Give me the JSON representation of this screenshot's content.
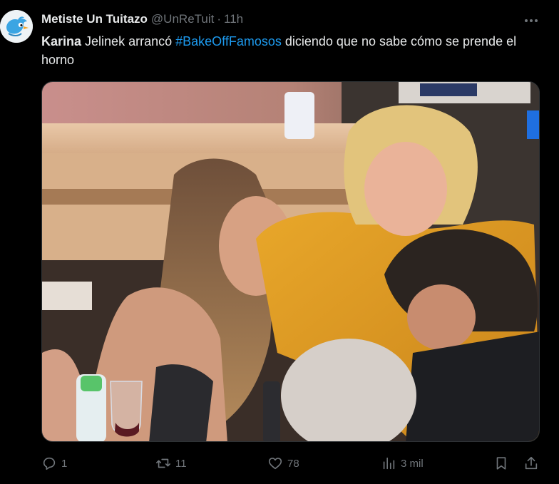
{
  "tweet": {
    "author": {
      "display_name": "Metiste Un Tuitazo",
      "handle": "@UnReTuit",
      "separator": "·",
      "time": "11h",
      "avatar_icon": "bird-avatar-icon"
    },
    "text_parts": {
      "bold_name": "Karina",
      "before_hashtag": " Jelinek arrancó  ",
      "hashtag": "#BakeOffFamosos",
      "after_hashtag": " diciendo que no sabe cómo se prende el horno"
    },
    "media": {
      "kind": "video-still",
      "description_icon": "tv-scene-image"
    },
    "actions": {
      "replies": "1",
      "retweets": "11",
      "likes": "78",
      "views": "3 mil"
    },
    "colors": {
      "background": "#000000",
      "text": "#e7e9ea",
      "muted": "#71767b",
      "link": "#1d9bf0"
    }
  }
}
